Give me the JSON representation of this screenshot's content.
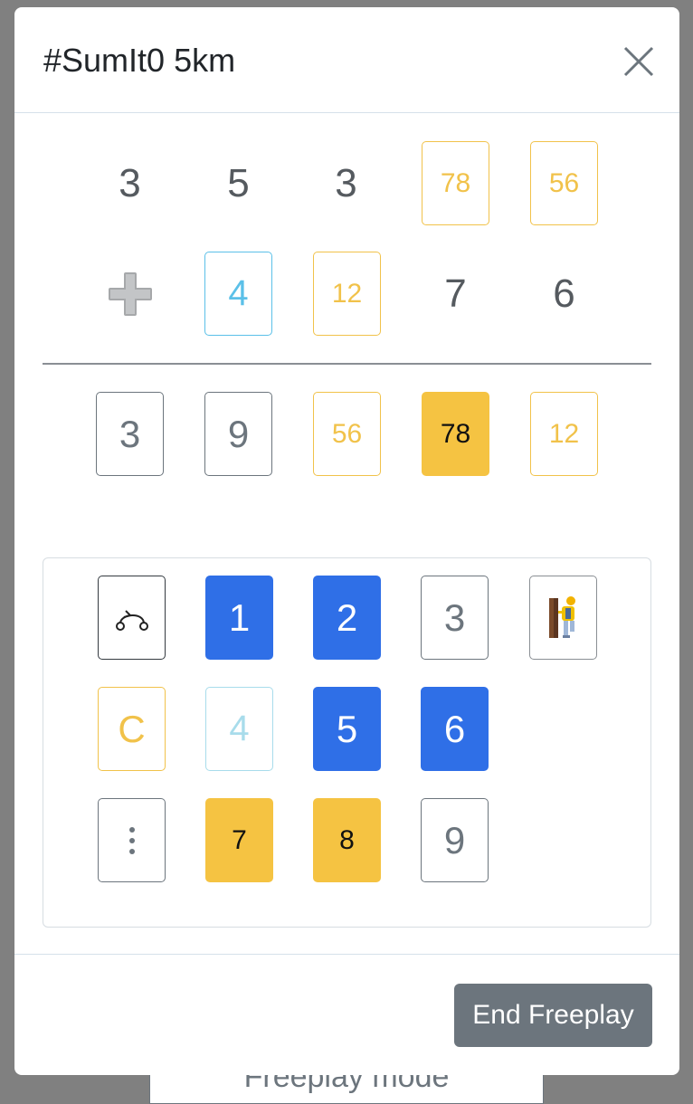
{
  "background_text": "Freeplay mode",
  "modal": {
    "title": "#SumIt0 5km"
  },
  "puzzle": {
    "row1": [
      "3",
      "5",
      "3",
      "78",
      "56"
    ],
    "row2": [
      "4",
      "12",
      "7",
      "6"
    ],
    "answer": [
      "3",
      "9",
      "56",
      "78",
      "12"
    ]
  },
  "keypad": {
    "row1": [
      "1",
      "2",
      "3"
    ],
    "row2": [
      "C",
      "4",
      "5",
      "6"
    ],
    "row3": [
      "7",
      "8",
      "9"
    ]
  },
  "footer": {
    "end_label": "End Freeplay"
  },
  "colors": {
    "accent_blue": "#2f6fe7",
    "accent_yellow": "#f5c342",
    "button_gray": "#6c757d"
  },
  "icons": [
    "close-icon",
    "plus-icon",
    "undo-icon",
    "climber-icon",
    "more-vertical-icon"
  ]
}
